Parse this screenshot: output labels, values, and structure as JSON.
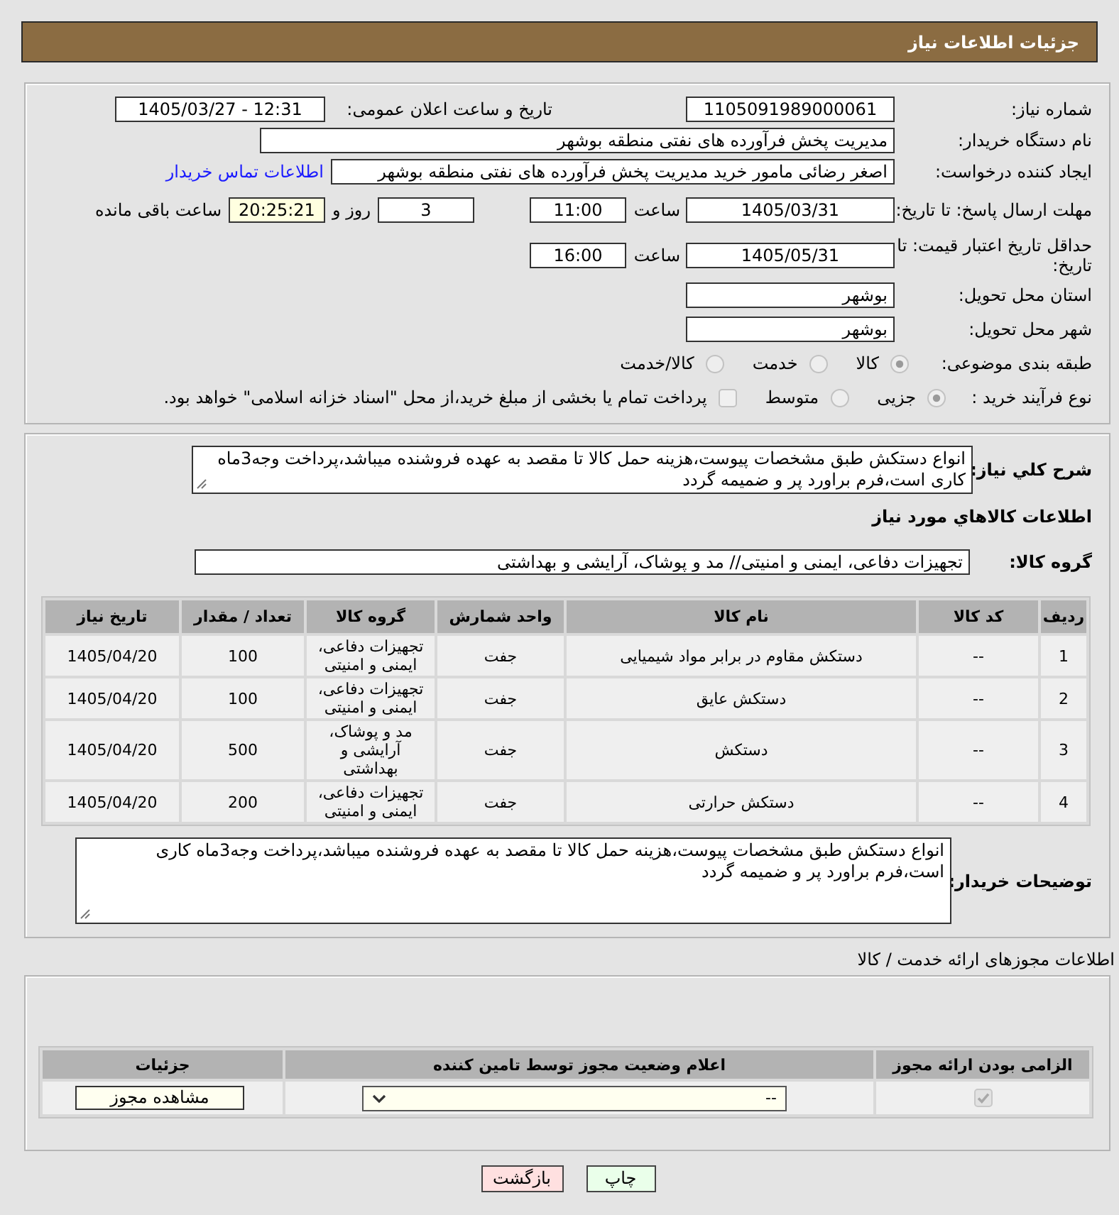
{
  "header": {
    "title": "جزئیات اطلاعات نیاز"
  },
  "details": {
    "need_number": {
      "label": "شماره نیاز:",
      "value": "1105091989000061"
    },
    "announcement": {
      "label": "تاریخ و ساعت اعلان عمومی:",
      "value": "1405/03/27 - 12:31"
    },
    "buyer_org": {
      "label": "نام دستگاه خریدار:",
      "value": "مدیریت پخش فرآورده های نفتی منطقه بوشهر"
    },
    "requester": {
      "label": "ایجاد کننده درخواست:",
      "value": "اصغر رضائی مامور خرید مدیریت پخش فرآورده های نفتی منطقه بوشهر",
      "contact_link": "اطلاعات تماس خریدار"
    },
    "response_deadline": {
      "label": "مهلت ارسال پاسخ: تا تاریخ:",
      "date": "1405/03/31",
      "time_label": "ساعت",
      "time": "11:00",
      "days": "3",
      "days_label": "روز و",
      "remaining": "20:25:21",
      "remaining_label": "ساعت باقی مانده"
    },
    "price_validity": {
      "label": "حداقل تاریخ اعتبار قیمت: تا تاریخ:",
      "date": "1405/05/31",
      "time_label": "ساعت",
      "time": "16:00"
    },
    "delivery_province": {
      "label": "استان محل تحویل:",
      "value": "بوشهر"
    },
    "delivery_city": {
      "label": "شهر محل تحویل:",
      "value": "بوشهر"
    },
    "category": {
      "label": "طبقه بندی موضوعی:",
      "options": [
        {
          "label": "کالا",
          "selected": true
        },
        {
          "label": "خدمت",
          "selected": false
        },
        {
          "label": "کالا/خدمت",
          "selected": false
        }
      ]
    },
    "purchase_process": {
      "label": "نوع فرآیند خرید :",
      "options": [
        {
          "label": "جزیی",
          "selected": true
        },
        {
          "label": "متوسط",
          "selected": false
        }
      ],
      "treasury": {
        "label": "پرداخت تمام یا بخشی از مبلغ خرید،از محل \"اسناد خزانه اسلامی\" خواهد بود.",
        "checked": false
      }
    }
  },
  "need": {
    "summary_label": "شرح کلي نياز:",
    "summary": "انواع دستکش طبق مشخصات پیوست،هزینه حمل کالا تا مقصد به عهده فروشنده میباشد،پرداخت وجه3ماه کاری است،فرم براورد پر و ضمیمه گردد",
    "goods_title": "اطلاعات کالاهاي مورد نياز",
    "group_label": "گروه کالا:",
    "group": "تجهیزات دفاعی، ایمنی و امنیتی// مد و پوشاک، آرایشی و بهداشتی",
    "table": {
      "columns": [
        "ردیف",
        "کد کالا",
        "نام کالا",
        "واحد شمارش",
        "گروه کالا",
        "تعداد / مقدار",
        "تاریخ نیاز"
      ],
      "rows": [
        [
          "1",
          "--",
          "دستکش مقاوم در برابر مواد شیمیایی",
          "جفت",
          "تجهیزات دفاعی، ایمنی و امنیتی",
          "100",
          "1405/04/20"
        ],
        [
          "2",
          "--",
          "دستکش عایق",
          "جفت",
          "تجهیزات دفاعی، ایمنی و امنیتی",
          "100",
          "1405/04/20"
        ],
        [
          "3",
          "--",
          "دستکش",
          "جفت",
          "مد و پوشاک، آرایشی و بهداشتی",
          "500",
          "1405/04/20"
        ],
        [
          "4",
          "--",
          "دستکش حرارتی",
          "جفت",
          "تجهیزات دفاعی، ایمنی و امنیتی",
          "200",
          "1405/04/20"
        ]
      ]
    },
    "buyer_notes_label": "توضیحات خریدار:",
    "buyer_notes": "انواع دستکش طبق مشخصات پیوست،هزینه حمل کالا تا مقصد به عهده فروشنده میباشد،پرداخت وجه3ماه کاری است،فرم براورد پر و ضمیمه گردد"
  },
  "permits": {
    "title": "اطلاعات مجوزهای ارائه خدمت / کالا",
    "columns": [
      "الزامی بودن ارائه مجوز",
      "اعلام وضعیت مجوز توسط تامین کننده",
      "جزئیات"
    ],
    "rows": [
      {
        "required": true,
        "status": "--",
        "details_button": "مشاهده مجوز"
      }
    ]
  },
  "buttons": [
    {
      "label": "چاپ",
      "kind": "print"
    },
    {
      "label": "بازگشت",
      "kind": "back"
    }
  ]
}
